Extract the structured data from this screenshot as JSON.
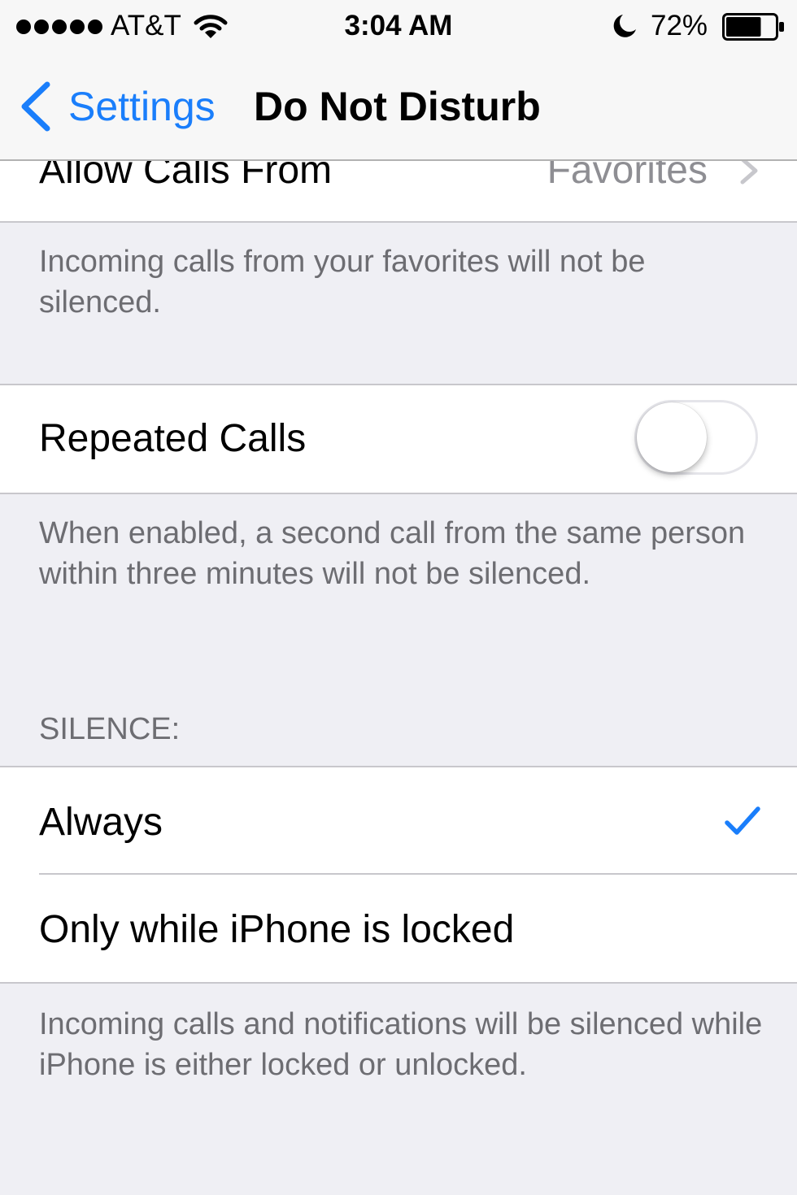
{
  "status_bar": {
    "signal_icon": "signal-dots-icon",
    "carrier": "AT&T",
    "wifi_icon": "wifi-icon",
    "time": "3:04 AM",
    "dnd_icon": "moon-icon",
    "battery_percent": "72%",
    "battery_level": 0.72,
    "battery_icon": "battery-icon"
  },
  "nav": {
    "back_label": "Settings",
    "title": "Do Not Disturb"
  },
  "allow_calls": {
    "label": "Allow Calls From",
    "value": "Favorites",
    "footer": "Incoming calls from your favorites will not be silenced."
  },
  "repeated_calls": {
    "label": "Repeated Calls",
    "enabled": false,
    "footer": "When enabled, a second call from the same person within three minutes will not be silenced."
  },
  "silence": {
    "header": "SILENCE:",
    "options": [
      {
        "label": "Always",
        "selected": true
      },
      {
        "label": "Only while iPhone is locked",
        "selected": false
      }
    ],
    "footer": "Incoming calls and notifications will be silenced while iPhone is either locked or unlocked."
  },
  "colors": {
    "accent": "#1a7efb",
    "background": "#efeff4",
    "secondary_text": "#6d6d72"
  }
}
